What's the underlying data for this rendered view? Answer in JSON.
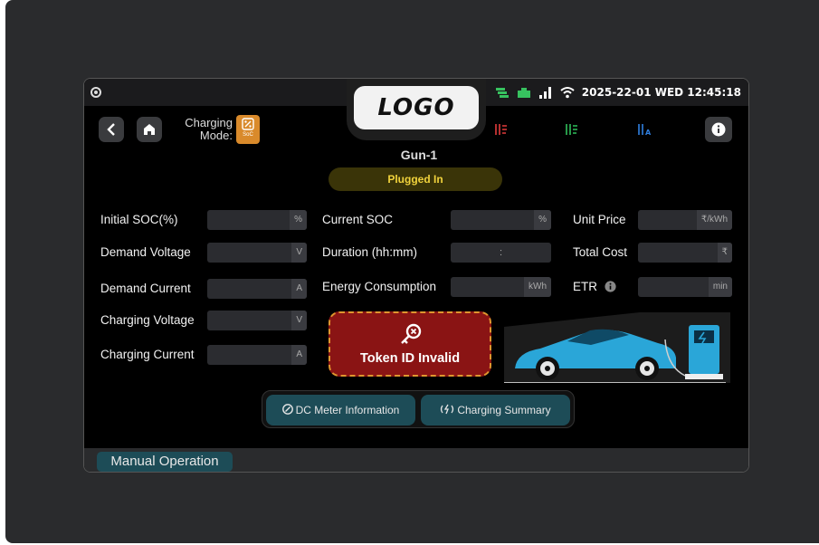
{
  "status_bar": {
    "datetime": "2025-22-01 WED 12:45:18",
    "icons": [
      "settings-dot-icon",
      "stack-icon",
      "ethernet-icon",
      "signal-icon",
      "wifi-icon"
    ]
  },
  "header": {
    "logo": "LOGO",
    "charging_mode_label": "Charging Mode:",
    "mode_badge": "SoC",
    "gun_name": "Gun-1",
    "status": "Plugged In",
    "phase_icons": [
      {
        "name": "phase-red-icon",
        "color": "#e23b3b"
      },
      {
        "name": "phase-green-icon",
        "color": "#2fbf5a"
      },
      {
        "name": "phase-blue-icon",
        "color": "#2f7fe0"
      }
    ]
  },
  "fields": {
    "left": [
      {
        "label": "Initial SOC(%)",
        "value": "",
        "unit": "%"
      },
      {
        "label": "Demand Voltage",
        "value": "",
        "unit": "V"
      },
      {
        "label": "Demand Current",
        "value": "",
        "unit": "A"
      },
      {
        "label": "Charging Voltage",
        "value": "",
        "unit": "V"
      },
      {
        "label": "Charging Current",
        "value": "",
        "unit": "A"
      }
    ],
    "middle": [
      {
        "label": "Current SOC",
        "value": "",
        "unit": "%"
      },
      {
        "label": "Duration (hh:mm)",
        "value": ":",
        "unit": ""
      },
      {
        "label": "Energy Consumption",
        "value": "",
        "unit": "kWh"
      }
    ],
    "right": [
      {
        "label": "Unit Price",
        "value": "",
        "unit": "₹/kWh"
      },
      {
        "label": "Total Cost",
        "value": "",
        "unit": "₹"
      },
      {
        "label": "ETR",
        "value": "",
        "unit": "min"
      }
    ]
  },
  "token": {
    "label": "Token ID Invalid"
  },
  "buttons": {
    "dc_meter": "DC Meter Information",
    "charging_summary": "Charging Summary",
    "manual_operation": "Manual Operation"
  },
  "colors": {
    "accent": "#1d4c57",
    "token_bg": "#8a1414",
    "token_border": "#e0952e",
    "plugged_text": "#f0d23c",
    "mode_badge": "#d98a2b"
  }
}
